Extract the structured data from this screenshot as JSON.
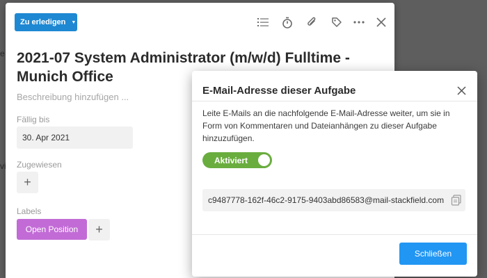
{
  "background": {
    "hint_a": "e",
    "hint_b": "vi"
  },
  "task": {
    "status_label": "Zu erledigen",
    "toolbar_icons": [
      "list-icon",
      "stopwatch-icon",
      "paperclip-icon",
      "tag-icon",
      "more-icon",
      "close-icon"
    ],
    "title": "2021-07 System Administrator (m/w/d) Fulltime - Munich Office",
    "description_placeholder": "Beschreibung hinzufügen ...",
    "due_label": "Fällig bis",
    "due_value": "30. Apr 2021",
    "assigned_label": "Zugewiesen",
    "labels_label": "Labels",
    "label_chip": "Open Position",
    "plus": "+",
    "colors": {
      "status": "#1e88d3",
      "label_chip": "#c26bd6"
    }
  },
  "dialog": {
    "title": "E-Mail-Adresse dieser Aufgabe",
    "description": "Leite E-Mails an die nachfolgende E-Mail-Adresse weiter, um sie in Form von Kommentaren und Dateianhängen zu dieser Aufgabe hinzuzufügen.",
    "toggle_label": "Aktiviert",
    "toggle_on": true,
    "email": "c9487778-162f-46c2-9175-9403abd86583@mail-stackfield.com",
    "close_button": "Schließen",
    "colors": {
      "toggle": "#6aad3f",
      "primary": "#2196f3"
    }
  }
}
